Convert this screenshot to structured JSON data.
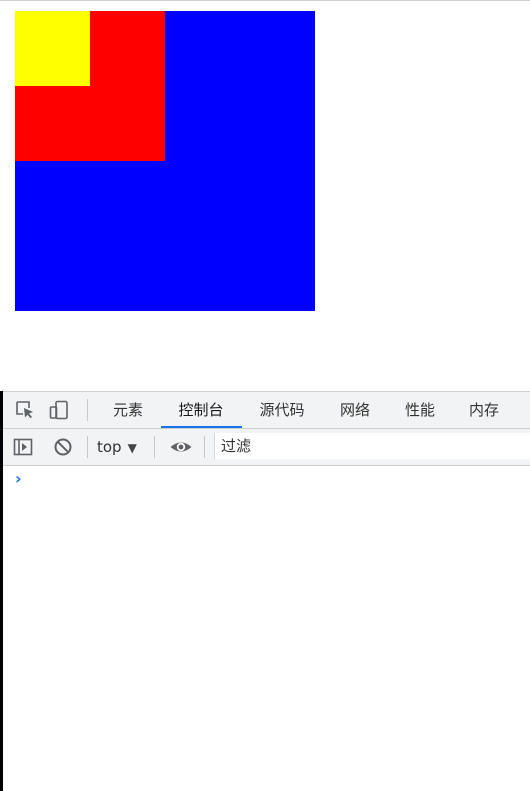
{
  "page": {
    "boxes": {
      "outer_color": "#0000ff",
      "middle_color": "#ff0000",
      "inner_color": "#ffff00"
    }
  },
  "devtools": {
    "tabs": [
      {
        "label": "元素"
      },
      {
        "label": "控制台"
      },
      {
        "label": "源代码"
      },
      {
        "label": "网络"
      },
      {
        "label": "性能"
      },
      {
        "label": "内存"
      }
    ],
    "active_tab": "控制台",
    "accent_color": "#1a73e8",
    "toolbar": {
      "context": "top",
      "filter_placeholder": "过滤"
    },
    "console": {
      "prompt_symbol": "›"
    },
    "icons": {
      "inspect": "inspect-element-icon",
      "device": "device-toolbar-icon",
      "sidebar": "show-sidebar-icon",
      "clear": "clear-console-icon",
      "eye": "live-expression-icon"
    }
  }
}
